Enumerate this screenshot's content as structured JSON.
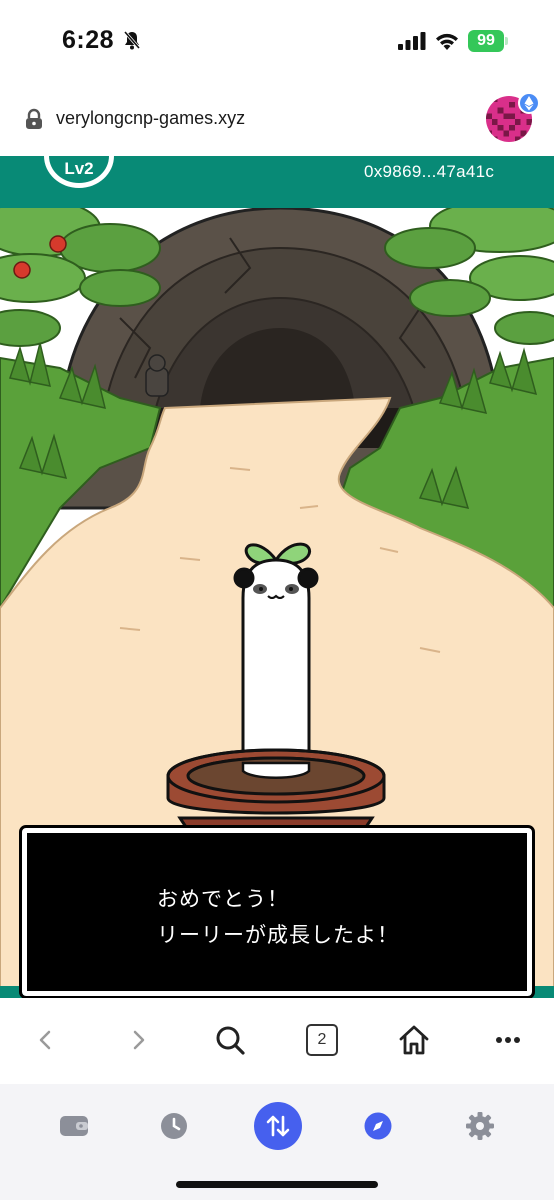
{
  "status_bar": {
    "time": "6:28",
    "battery": "99"
  },
  "browser": {
    "url": "verylongcnp-games.xyz",
    "tab_count": "2"
  },
  "game": {
    "level": "Lv2",
    "wallet_address": "0x9869...47a41c",
    "dialog": {
      "line1": "おめでとう！",
      "line2": "リーリーが成長したよ！"
    }
  },
  "icons": {
    "status": [
      "bell-slash-icon",
      "cellular-signal-icon",
      "wifi-icon",
      "battery-icon"
    ],
    "url_bar": [
      "lock-icon",
      "wallet-avatar",
      "ethereum-icon"
    ],
    "toolbar": [
      "chevron-left-icon",
      "chevron-right-icon",
      "search-icon",
      "tabs-icon",
      "home-icon",
      "more-icon"
    ],
    "app_nav": [
      "wallet-icon",
      "clock-icon",
      "swap-icon",
      "compass-icon",
      "gear-icon"
    ]
  },
  "colors": {
    "header_teal": "#088a76",
    "swap_accent": "#4660ee",
    "battery_green": "#34c759",
    "dialog_bg": "#000000"
  }
}
